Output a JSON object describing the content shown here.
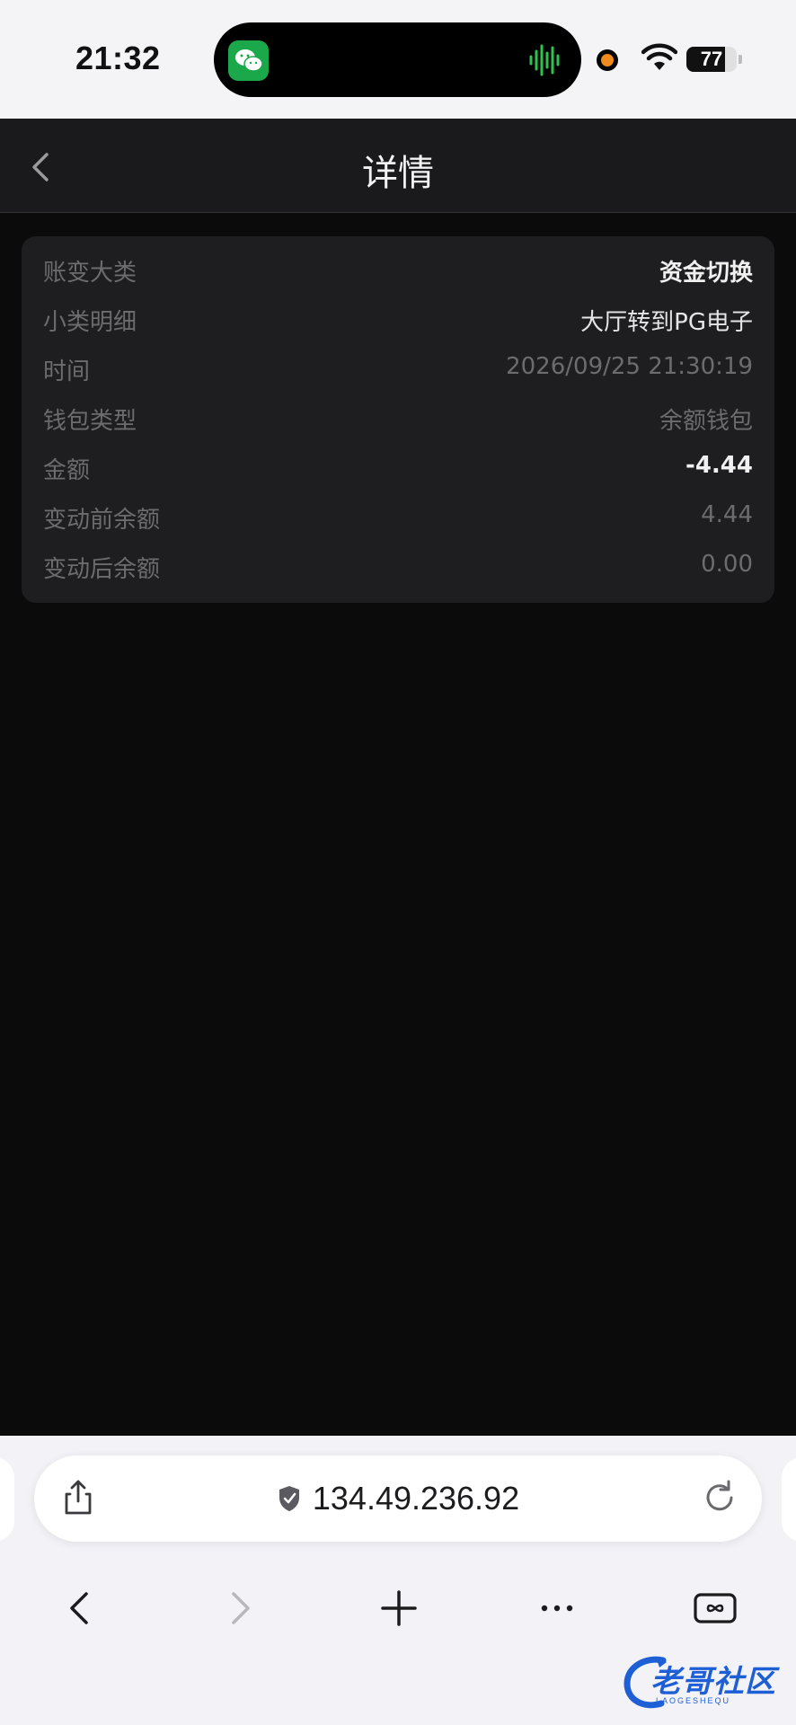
{
  "status_bar": {
    "time": "21:32",
    "battery": "77",
    "battery_level_percent": 77,
    "app_icon": "wechat-icon",
    "accent_green": "#1ba84b",
    "recording_dot_color": "#f08a1c"
  },
  "header": {
    "title": "详情",
    "back_icon": "chevron-left-icon"
  },
  "details": {
    "rows": [
      {
        "label": "账变大类",
        "value": "资金切换"
      },
      {
        "label": "小类明细",
        "value": "大厅转到PG电子"
      },
      {
        "label": "时间",
        "value": "2026/09/25 21:30:19"
      },
      {
        "label": "钱包类型",
        "value": "余额钱包"
      },
      {
        "label": "金额",
        "value": "-4.44"
      },
      {
        "label": "变动前余额",
        "value": "4.44"
      },
      {
        "label": "变动后余额",
        "value": "0.00"
      }
    ]
  },
  "browser": {
    "url": "134.49.236.92",
    "icons": {
      "share": "share-icon",
      "secure": "shield-check-icon",
      "reload": "reload-icon",
      "back": "chevron-left-icon",
      "forward": "chevron-right-icon",
      "new_tab": "plus-icon",
      "more": "more-icon",
      "tabs": "tabs-icon"
    }
  },
  "watermark": {
    "text": "老哥社区",
    "subtext": "LAOGESHEQU"
  }
}
